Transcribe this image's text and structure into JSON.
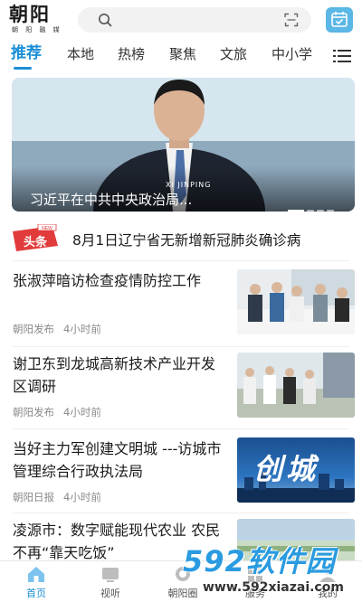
{
  "header": {
    "logo_main": "朝阳",
    "logo_sub": "朝 阳 融 媒",
    "search_placeholder": ""
  },
  "tabs": [
    {
      "label": "推荐",
      "active": true
    },
    {
      "label": "本地"
    },
    {
      "label": "热榜"
    },
    {
      "label": "聚焦"
    },
    {
      "label": "文旅"
    },
    {
      "label": "中小学"
    }
  ],
  "banner": {
    "title": "习近平在中共中央政治局...",
    "caption": "XI JINPING"
  },
  "headline": {
    "badge": "头条",
    "badge_tag": "NEW",
    "text": "8月1日辽宁省无新增新冠肺炎确诊病"
  },
  "news": [
    {
      "title": "张淑萍暗访检查疫情防控工作",
      "source": "朝阳发布",
      "time": "4小时前"
    },
    {
      "title": "谢卫东到龙城高新技术产业开发区调研",
      "source": "朝阳发布",
      "time": "4小时前"
    },
    {
      "title": "当好主力军创建文明城 ---访城市管理综合行政执法局",
      "source": "朝阳日报",
      "time": "4小时前",
      "thumb_text": "创城"
    },
    {
      "title": "凌源市：数字赋能现代农业 农民不再“靠天吃饭”",
      "source": "",
      "time": ""
    }
  ],
  "bottom_nav": [
    {
      "label": "首页",
      "active": true,
      "icon": "home-icon"
    },
    {
      "label": "视听",
      "icon": "tv-icon"
    },
    {
      "label": "朝阳圈",
      "icon": "circle-icon"
    },
    {
      "label": "服务",
      "icon": "service-icon"
    },
    {
      "label": "我的",
      "icon": "user-icon"
    }
  ],
  "watermark": {
    "brand": "592软件园",
    "url": "www.592xiazai.com"
  },
  "colors": {
    "accent": "#1a8fd6",
    "badge_red": "#e23b3b",
    "calendar_button": "#5ab7e6"
  }
}
